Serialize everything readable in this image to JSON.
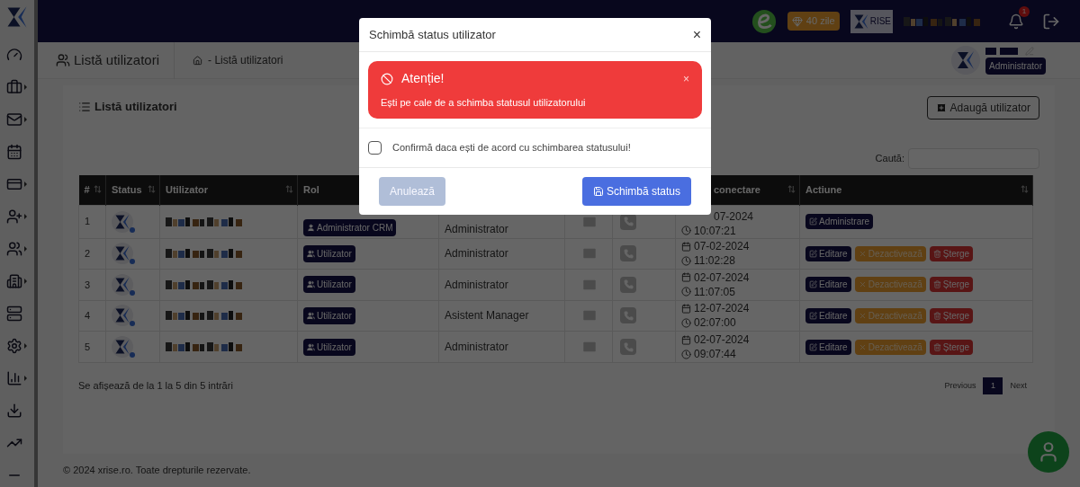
{
  "topbar": {
    "trial_badge": "40 zile",
    "logo_text": "RISE",
    "notifications": "1"
  },
  "sidebar": {
    "items": [
      {
        "submenu": false
      },
      {
        "submenu": true
      },
      {
        "submenu": true
      },
      {
        "submenu": false
      },
      {
        "submenu": true
      },
      {
        "submenu": true
      },
      {
        "submenu": true
      },
      {
        "submenu": true
      },
      {
        "submenu": false
      },
      {
        "submenu": true
      },
      {
        "submenu": true
      },
      {
        "submenu": false
      },
      {
        "submenu": false
      },
      {
        "submenu": false
      }
    ]
  },
  "page_header": {
    "title": "Listă utilizatori",
    "breadcrumb_separator": "-",
    "breadcrumb": "Listă utilizatori",
    "user_role": "Administrator"
  },
  "card": {
    "title": "Listă utilizatori",
    "add_button": "Adaugă utilizator",
    "search_label": "Caută:"
  },
  "table": {
    "columns": [
      "#",
      "Status",
      "Utilizator",
      "Rol",
      "",
      "",
      "",
      "conectare",
      "Actiune"
    ],
    "rows": [
      {
        "number": "1",
        "role_badge": {
          "label": "Administrator CRM",
          "kind": "crm"
        },
        "role": "Administrator",
        "date": "07-2024",
        "time": "10:07:21",
        "actions": [
          {
            "label": "Administrare",
            "kind": "admin"
          }
        ]
      },
      {
        "number": "2",
        "role_badge": {
          "label": "Utilizator",
          "kind": "user"
        },
        "role": "Administrator",
        "date": "07-02-2024",
        "time": "11:02:28",
        "actions": [
          {
            "label": "Editare",
            "kind": "edit"
          },
          {
            "label": "Dezactivează",
            "kind": "deactivate"
          },
          {
            "label": "Șterge",
            "kind": "delete"
          }
        ]
      },
      {
        "number": "3",
        "role_badge": {
          "label": "Utilizator",
          "kind": "user"
        },
        "role": "Administrator",
        "date": "02-07-2024",
        "time": "11:07:05",
        "actions": [
          {
            "label": "Editare",
            "kind": "edit"
          },
          {
            "label": "Dezactivează",
            "kind": "deactivate"
          },
          {
            "label": "Șterge",
            "kind": "delete"
          }
        ]
      },
      {
        "number": "4",
        "role_badge": {
          "label": "Utilizator",
          "kind": "user"
        },
        "role": "Asistent Manager",
        "date": "12-07-2024",
        "time": "02:07:00",
        "actions": [
          {
            "label": "Editare",
            "kind": "edit"
          },
          {
            "label": "Dezactivează",
            "kind": "deactivate"
          },
          {
            "label": "Șterge",
            "kind": "delete"
          }
        ]
      },
      {
        "number": "5",
        "role_badge": {
          "label": "Utilizator",
          "kind": "user"
        },
        "role": "Administrator",
        "date": "02-07-2024",
        "time": "09:07:44",
        "actions": [
          {
            "label": "Editare",
            "kind": "edit"
          },
          {
            "label": "Dezactivează",
            "kind": "deactivate"
          },
          {
            "label": "Șterge",
            "kind": "delete"
          }
        ]
      }
    ],
    "info": "Se afișează de la 1 la 5 din 5 intrări",
    "pagination": [
      {
        "label": "Previous",
        "selected": false
      },
      {
        "label": "1",
        "selected": true
      },
      {
        "label": "Next",
        "selected": false
      }
    ]
  },
  "footer": "© 2024 xrise.ro. Toate drepturile rezervate.",
  "modal": {
    "title": "Schimbă status utilizator",
    "close": "×",
    "alert": {
      "title": "Atenție!",
      "message": "Ești pe cale de a schimba statusul utilizatorului",
      "close": "×"
    },
    "confirm": {
      "label": "Confirmă daca ești de acord cu schimbarea statusului!",
      "checked": false
    },
    "buttons": [
      {
        "label": "Anulează",
        "kind": "cancel",
        "disabled": true
      },
      {
        "label": "Schimbă status",
        "kind": "submit",
        "disabled": false
      }
    ]
  }
}
